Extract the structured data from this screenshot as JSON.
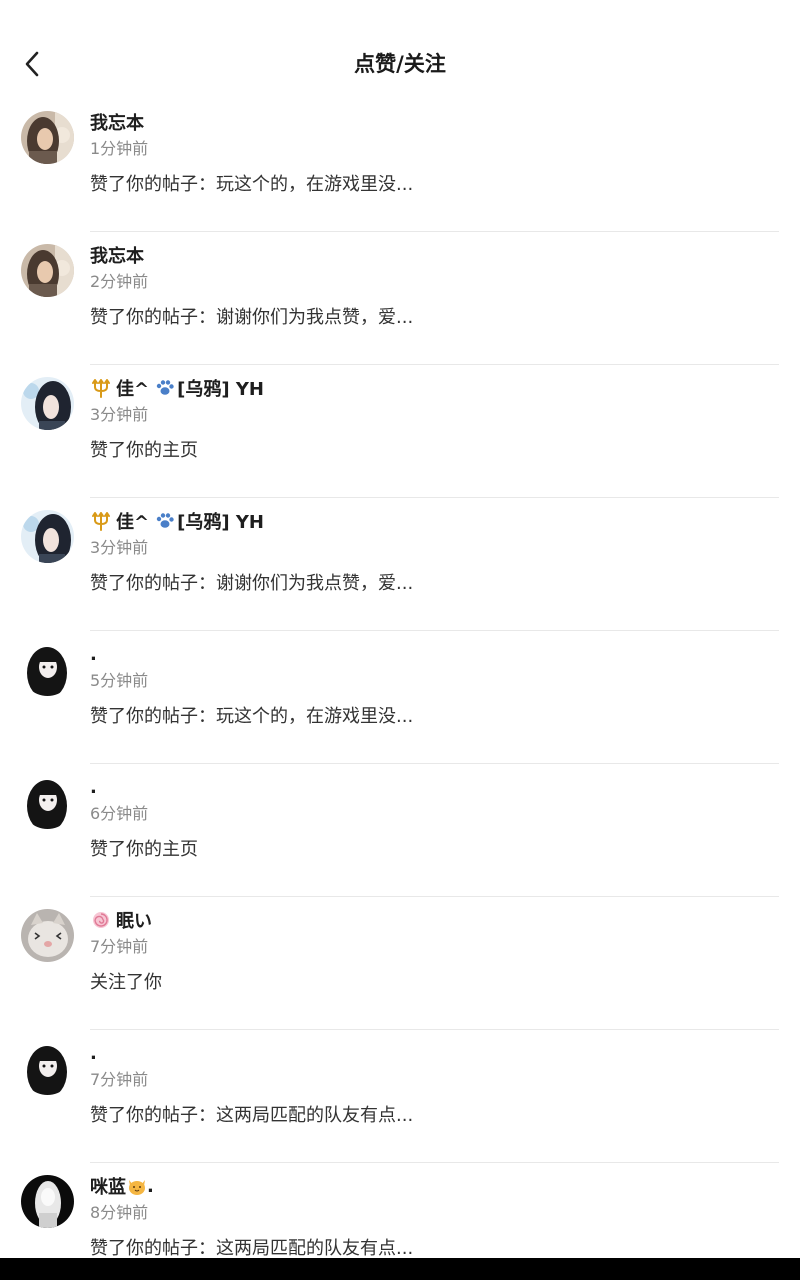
{
  "header": {
    "title": "点赞/关注",
    "back_icon": "chevron-left-icon"
  },
  "notifications": [
    {
      "name": "我忘本",
      "time": "1分钟前",
      "message": "赞了你的帖子：玩这个的，在游戏里没...",
      "avatar": "girl-photo-avatar"
    },
    {
      "name": "我忘本",
      "time": "2分钟前",
      "message": "赞了你的帖子：谢谢你们为我点赞，爱...",
      "avatar": "girl-photo-avatar"
    },
    {
      "name_prefix_icon": "trident-icon",
      "name": "佳^",
      "name_mid_icon": "paw-icon",
      "name_suffix": "[乌鸦] YH",
      "time": "3分钟前",
      "message": "赞了你的主页",
      "avatar": "anime-girl-avatar"
    },
    {
      "name_prefix_icon": "trident-icon",
      "name": "佳^",
      "name_mid_icon": "paw-icon",
      "name_suffix": "[乌鸦] YH",
      "time": "3分钟前",
      "message": "赞了你的帖子：谢谢你们为我点赞，爱...",
      "avatar": "anime-girl-avatar"
    },
    {
      "name": ".",
      "time": "5分钟前",
      "message": "赞了你的帖子：玩这个的，在游戏里没...",
      "avatar": "anime-dark-hair-avatar"
    },
    {
      "name": ".",
      "time": "6分钟前",
      "message": "赞了你的主页",
      "avatar": "anime-dark-hair-avatar"
    },
    {
      "name_prefix_icon": "lollipop-icon",
      "name": "眠い",
      "time": "7分钟前",
      "message": "关注了你",
      "avatar": "cat-avatar"
    },
    {
      "name": ".",
      "time": "7分钟前",
      "message": "赞了你的帖子：这两局匹配的队友有点...",
      "avatar": "anime-dark-hair-avatar"
    },
    {
      "name": "咪蓝",
      "name_suffix_icon": "cat-face-icon",
      "name_suffix": ".",
      "time": "8分钟前",
      "message": "赞了你的帖子：这两局匹配的队友有点...",
      "avatar": "dark-anime-avatar"
    }
  ]
}
